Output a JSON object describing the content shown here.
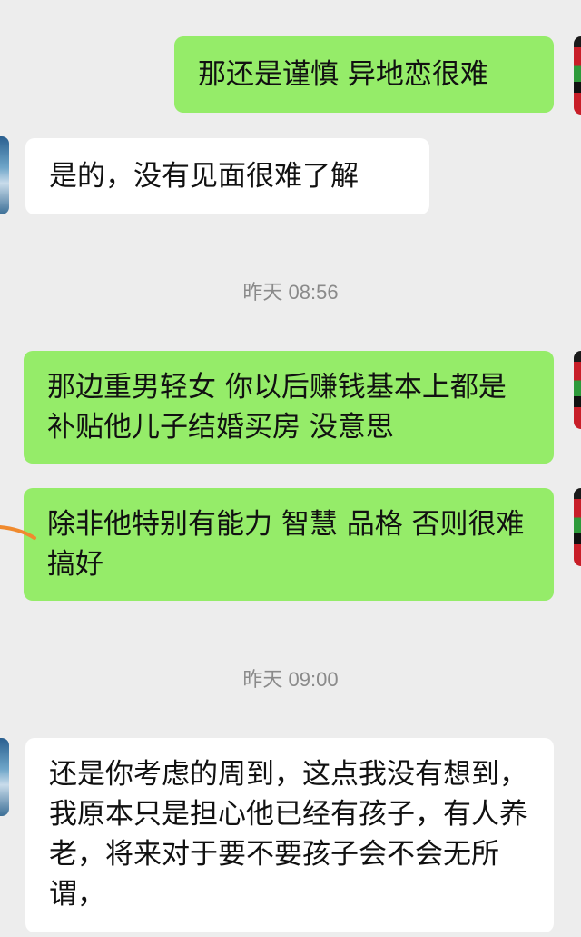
{
  "colors": {
    "background": "#ededed",
    "my_bubble": "#95ec69",
    "their_bubble": "#ffffff",
    "timestamp_text": "#8a8a8a"
  },
  "messages": [
    {
      "sender": "me",
      "text": "那还是谨慎 异地恋很难"
    },
    {
      "sender": "them",
      "text": "是的，没有见面很难了解"
    },
    {
      "sender": "me",
      "text": "那边重男轻女 你以后赚钱基本上都是补贴他儿子结婚买房 没意思"
    },
    {
      "sender": "me",
      "text": "除非他特别有能力 智慧 品格 否则很难搞好"
    },
    {
      "sender": "them",
      "text": "还是你考虑的周到，这点我没有想到，我原本只是担心他已经有孩子，有人养老，将来对于要不要孩子会不会无所谓，"
    }
  ],
  "timestamps": [
    "昨天 08:56",
    "昨天 09:00"
  ],
  "icons": {
    "my_avatar": "avatar-icon",
    "their_avatar": "avatar-icon",
    "annotation": "orange-stroke-icon"
  }
}
